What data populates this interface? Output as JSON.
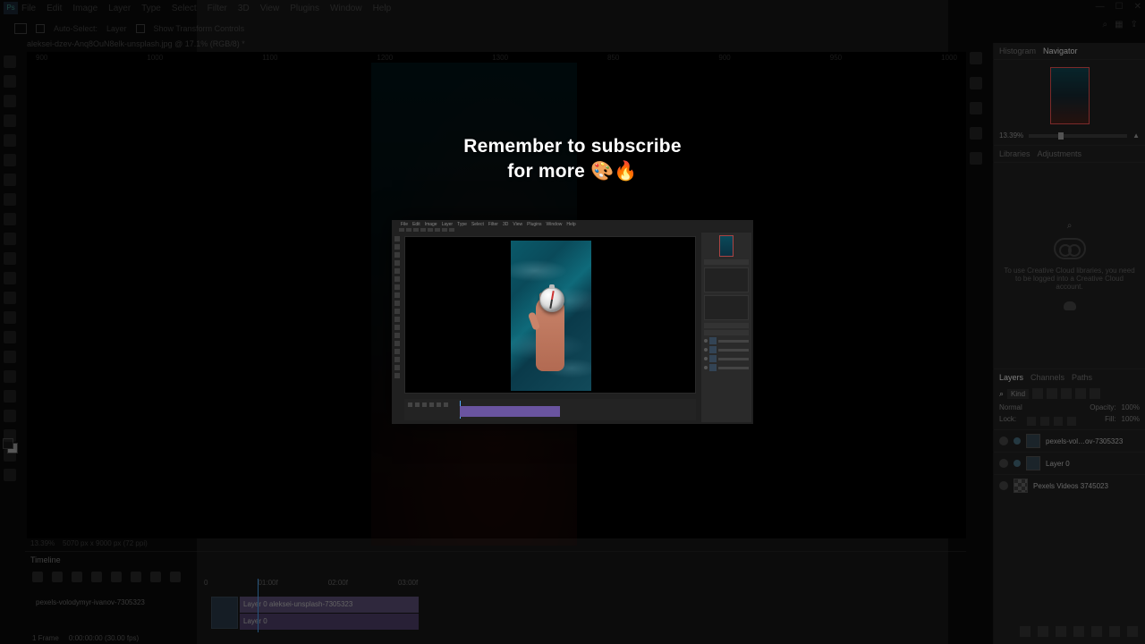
{
  "menubar": [
    "File",
    "Edit",
    "Image",
    "Layer",
    "Type",
    "Select",
    "Filter",
    "3D",
    "View",
    "Plugins",
    "Window",
    "Help"
  ],
  "options": {
    "auto_select": "Auto-Select:",
    "target": "Layer",
    "transform": "Show Transform Controls"
  },
  "doc_tab": "aleksei-dzev-Anq8OuN8elk-unsplash.jpg @ 17.1% (RGB/8) *",
  "ruler_top": [
    "900",
    "1000",
    "1100",
    "1200",
    "1300",
    "850",
    "900",
    "950",
    "1000"
  ],
  "status": {
    "zoom": "13.39%",
    "dims": "5070 px x 9000 px (72 ppi)"
  },
  "timeline": {
    "title": "Timeline",
    "marks": [
      "0",
      "01:00f",
      "02:00f",
      "03:00f"
    ],
    "track_label": "pexels-volodymyr-ivanov-7305323",
    "clip1": "Layer 0       aleksei-unsplash-7305323",
    "clip2": "Layer 0",
    "foot_left": "1 Frame",
    "foot_time": "0:00:00:00   (30.00 fps)"
  },
  "right": {
    "nav_tabs": [
      "Histogram",
      "Navigator"
    ],
    "nav_zoom": "13.39%",
    "lib_tabs": [
      "Libraries",
      "Adjustments"
    ],
    "lib_msg": "To use Creative Cloud libraries, you need to be logged into a Creative Cloud account.",
    "layers_tabs": [
      "Layers",
      "Channels",
      "Paths"
    ],
    "filter_kind": "Kind",
    "blend": "Normal",
    "opacity_label": "Opacity:",
    "opacity": "100%",
    "lock": "Lock:",
    "fill_label": "Fill:",
    "fill": "100%",
    "layer1": "pexels-vol…ov-7305323",
    "layer2": "Layer 0",
    "layer3": "Pexels Videos 3745023"
  },
  "overlay": {
    "line1": "Remember to subscribe",
    "line2": "for more 🎨🔥"
  },
  "mini": {
    "menu": [
      "File",
      "Edit",
      "Image",
      "Layer",
      "Type",
      "Select",
      "Filter",
      "3D",
      "View",
      "Plugins",
      "Window",
      "Help"
    ]
  }
}
